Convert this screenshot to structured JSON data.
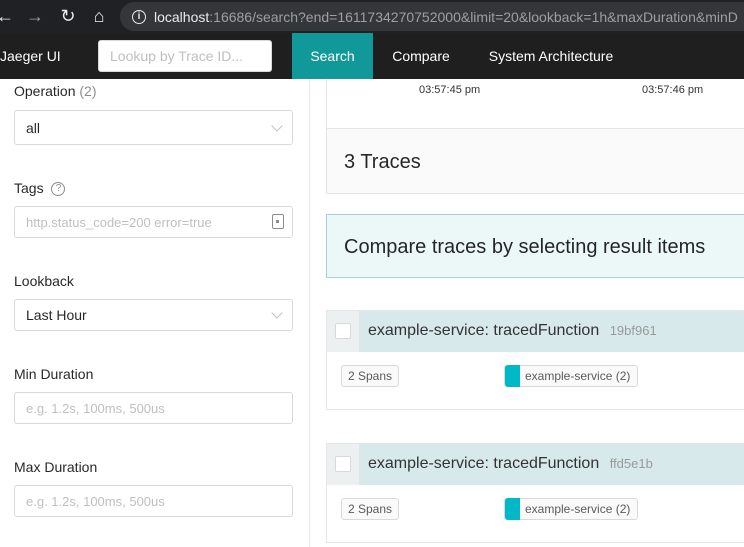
{
  "browser": {
    "url_host": "localhost",
    "url_rest": ":16686/search?end=1611734270752000&limit=20&lookback=1h&maxDuration&minD"
  },
  "topnav": {
    "brand": "Jaeger UI",
    "lookup_placeholder": "Lookup by Trace ID...",
    "items": [
      "Search",
      "Compare",
      "System Architecture"
    ],
    "active_color": "#119999"
  },
  "form": {
    "operation_label": "Operation",
    "operation_count": "(2)",
    "operation_value": "all",
    "tags_label": "Tags",
    "tags_help_icon": "question-circle-icon",
    "tags_placeholder": "http.status_code=200 error=true",
    "lookback_label": "Lookback",
    "lookback_value": "Last Hour",
    "min_duration_label": "Min Duration",
    "min_duration_placeholder": "e.g. 1.2s, 100ms, 500us",
    "max_duration_label": "Max Duration",
    "max_duration_placeholder": "e.g. 1.2s, 100ms, 500us"
  },
  "results": {
    "scatter_ticks": [
      "03:57:45 pm",
      "03:57:46 pm"
    ],
    "traces_count": "3 Traces",
    "compare_banner": "Compare traces by selecting result items",
    "traces": [
      {
        "service": "example-service:",
        "operation": "tracedFunction",
        "trace_id": "19bf961",
        "spans": "2 Spans",
        "service_tag": "example-service (2)",
        "color": "#00b8c8"
      },
      {
        "service": "example-service:",
        "operation": "tracedFunction",
        "trace_id": "ffd5e1b",
        "spans": "2 Spans",
        "service_tag": "example-service (2)",
        "color": "#00b8c8"
      }
    ]
  }
}
